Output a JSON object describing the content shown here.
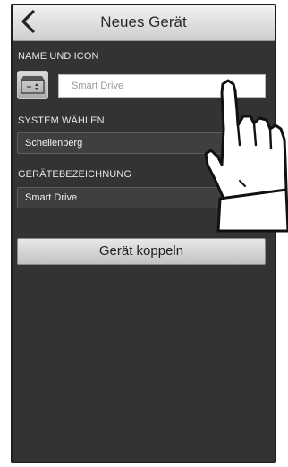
{
  "header": {
    "title": "Neues Gerät"
  },
  "name_section": {
    "label": "NAME UND ICON",
    "name_value": "Smart Drive"
  },
  "system_section": {
    "label": "SYSTEM WÄHLEN",
    "value": "Schellenberg"
  },
  "device_section": {
    "label": "GERÄTEBEZEICHNUNG",
    "value": "Smart Drive"
  },
  "pair_button": {
    "label": "Gerät koppeln"
  },
  "icons": {
    "back": "chevron-left-icon",
    "device": "garage-door-icon",
    "pointer": "hand-pointer-icon"
  }
}
